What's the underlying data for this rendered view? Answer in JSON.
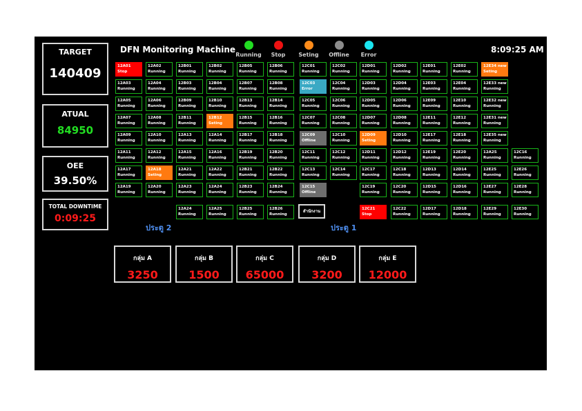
{
  "header": {
    "title": "DFN Monitoring Machine",
    "time": "8:09:25 AM"
  },
  "legend": [
    {
      "label": "Running",
      "color": "#22dd22"
    },
    {
      "label": "Stop",
      "color": "#ee1111"
    },
    {
      "label": "Seting",
      "color": "#ff8c1a"
    },
    {
      "label": "Offline",
      "color": "#8c8c8c"
    },
    {
      "label": "Error",
      "color": "#1ae5f0"
    }
  ],
  "status_colors": {
    "Running": "#000000",
    "Stop": "#ff0000",
    "Seting": "#ff7a10",
    "Offline": "#6e6e6e",
    "Error": "#3aa9c4"
  },
  "kpis": {
    "target": {
      "label": "TARGET",
      "value": "140409"
    },
    "actual": {
      "label": "ATUAL",
      "value": "84950"
    },
    "oee": {
      "label": "OEE",
      "value": "39.50%"
    },
    "downtime": {
      "label": "TOTAL DOWNTIME",
      "value": "0:09:25"
    }
  },
  "machines": [
    {
      "id": "12A01",
      "status": "Stop"
    },
    {
      "id": "12A02",
      "status": "Running"
    },
    {
      "id": "12B01",
      "status": "Running"
    },
    {
      "id": "12B02",
      "status": "Running"
    },
    {
      "id": "12B05",
      "status": "Running"
    },
    {
      "id": "12B06",
      "status": "Running"
    },
    {
      "id": "12C01",
      "status": "Running"
    },
    {
      "id": "12C02",
      "status": "Running"
    },
    {
      "id": "12D01",
      "status": "Running"
    },
    {
      "id": "12D02",
      "status": "Running"
    },
    {
      "id": "12E01",
      "status": "Running"
    },
    {
      "id": "12E02",
      "status": "Running"
    },
    {
      "id": "12E34 new",
      "status": "Seting"
    },
    {
      "id": "12A03",
      "status": "Running"
    },
    {
      "id": "12A04",
      "status": "Running"
    },
    {
      "id": "12B03",
      "status": "Running"
    },
    {
      "id": "12B04",
      "status": "Running"
    },
    {
      "id": "12B07",
      "status": "Running"
    },
    {
      "id": "12B08",
      "status": "Running"
    },
    {
      "id": "12C03",
      "status": "Error"
    },
    {
      "id": "12C04",
      "status": "Running"
    },
    {
      "id": "12D03",
      "status": "Running"
    },
    {
      "id": "12D04",
      "status": "Running"
    },
    {
      "id": "12E03",
      "status": "Running"
    },
    {
      "id": "12E04",
      "status": "Running"
    },
    {
      "id": "12E33 new",
      "status": "Running"
    },
    {
      "id": "12A05",
      "status": "Running"
    },
    {
      "id": "12A06",
      "status": "Running"
    },
    {
      "id": "12B09",
      "status": "Running"
    },
    {
      "id": "12B10",
      "status": "Running"
    },
    {
      "id": "12B13",
      "status": "Running"
    },
    {
      "id": "12B14",
      "status": "Running"
    },
    {
      "id": "12C05",
      "status": "Running"
    },
    {
      "id": "12C06",
      "status": "Running"
    },
    {
      "id": "12D05",
      "status": "Running"
    },
    {
      "id": "12D06",
      "status": "Running"
    },
    {
      "id": "12E09",
      "status": "Running"
    },
    {
      "id": "12E10",
      "status": "Running"
    },
    {
      "id": "12E32 new",
      "status": "Running"
    },
    {
      "id": "12A07",
      "status": "Running"
    },
    {
      "id": "12A08",
      "status": "Running"
    },
    {
      "id": "12B11",
      "status": "Running"
    },
    {
      "id": "12B12",
      "status": "Seting"
    },
    {
      "id": "12B15",
      "status": "Running"
    },
    {
      "id": "12B16",
      "status": "Running"
    },
    {
      "id": "12C07",
      "status": "Running"
    },
    {
      "id": "12C08",
      "status": "Running"
    },
    {
      "id": "12D07",
      "status": "Running"
    },
    {
      "id": "12D08",
      "status": "Running"
    },
    {
      "id": "12E11",
      "status": "Running"
    },
    {
      "id": "12E12",
      "status": "Running"
    },
    {
      "id": "12E31 new",
      "status": "Running"
    },
    {
      "id": "12A09",
      "status": "Running"
    },
    {
      "id": "12A10",
      "status": "Running"
    },
    {
      "id": "12A13",
      "status": "Running"
    },
    {
      "id": "12A14",
      "status": "Running"
    },
    {
      "id": "12B17",
      "status": "Running"
    },
    {
      "id": "12B18",
      "status": "Running"
    },
    {
      "id": "12C09",
      "status": "Offline"
    },
    {
      "id": "12C10",
      "status": "Running"
    },
    {
      "id": "12D09",
      "status": "Seting"
    },
    {
      "id": "12D10",
      "status": "Running"
    },
    {
      "id": "12E17",
      "status": "Running"
    },
    {
      "id": "12E18",
      "status": "Running"
    },
    {
      "id": "12E35 new",
      "status": "Running"
    },
    {
      "id": "12A11",
      "status": "Running"
    },
    {
      "id": "12A12",
      "status": "Running"
    },
    {
      "id": "12A15",
      "status": "Running"
    },
    {
      "id": "12A16",
      "status": "Running"
    },
    {
      "id": "12B19",
      "status": "Running"
    },
    {
      "id": "12B20",
      "status": "Running"
    },
    {
      "id": "12C11",
      "status": "Running"
    },
    {
      "id": "12C12",
      "status": "Running"
    },
    {
      "id": "12D11",
      "status": "Running"
    },
    {
      "id": "12D12",
      "status": "Running"
    },
    {
      "id": "12E19",
      "status": "Running"
    },
    {
      "id": "12E20",
      "status": "Running"
    },
    {
      "id": "12A25",
      "status": "Running"
    },
    {
      "id": "12C16",
      "status": "Running"
    },
    {
      "id": "12A17",
      "status": "Running"
    },
    {
      "id": "12A18",
      "status": "Seting"
    },
    {
      "id": "12A21",
      "status": "Running"
    },
    {
      "id": "12A22",
      "status": "Running"
    },
    {
      "id": "12B21",
      "status": "Running"
    },
    {
      "id": "12B22",
      "status": "Running"
    },
    {
      "id": "12C13",
      "status": "Running"
    },
    {
      "id": "12C14",
      "status": "Running"
    },
    {
      "id": "12C17",
      "status": "Running"
    },
    {
      "id": "12C18",
      "status": "Running"
    },
    {
      "id": "12D13",
      "status": "Running"
    },
    {
      "id": "12D14",
      "status": "Running"
    },
    {
      "id": "12E25",
      "status": "Running"
    },
    {
      "id": "12E26",
      "status": "Running"
    },
    {
      "id": "12A19",
      "status": "Running"
    },
    {
      "id": "12A20",
      "status": "Running"
    },
    {
      "id": "12A23",
      "status": "Running"
    },
    {
      "id": "12A24",
      "status": "Running"
    },
    {
      "id": "12B23",
      "status": "Running"
    },
    {
      "id": "12B24",
      "status": "Running"
    },
    {
      "id": "12C15",
      "status": "Offline"
    },
    {
      "id": "12C19",
      "status": "Running"
    },
    {
      "id": "12C20",
      "status": "Running"
    },
    {
      "id": "12D15",
      "status": "Running"
    },
    {
      "id": "12D16",
      "status": "Running"
    },
    {
      "id": "12E27",
      "status": "Running"
    },
    {
      "id": "12E28",
      "status": "Running"
    },
    {
      "id": "12A24",
      "status": "Running"
    },
    {
      "id": "12A25",
      "status": "Running"
    },
    {
      "id": "12B25",
      "status": "Running"
    },
    {
      "id": "12B26",
      "status": "Running"
    },
    {
      "id": "12C21",
      "status": "Stop"
    },
    {
      "id": "12C22",
      "status": "Running"
    },
    {
      "id": "12D17",
      "status": "Running"
    },
    {
      "id": "12D18",
      "status": "Running"
    },
    {
      "id": "12E29",
      "status": "Running"
    },
    {
      "id": "12E30",
      "status": "Running"
    }
  ],
  "office_label": "สำนักงาน",
  "doors": [
    "ประตู 2",
    "ประตู 1"
  ],
  "groups": [
    {
      "label": "กลุ่ม A",
      "value": "3250"
    },
    {
      "label": "กลุ่ม B",
      "value": "1500"
    },
    {
      "label": "กลุ่ม C",
      "value": "65000"
    },
    {
      "label": "กลุ่ม D",
      "value": "3200"
    },
    {
      "label": "กลุ่ม E",
      "value": "12000"
    }
  ]
}
